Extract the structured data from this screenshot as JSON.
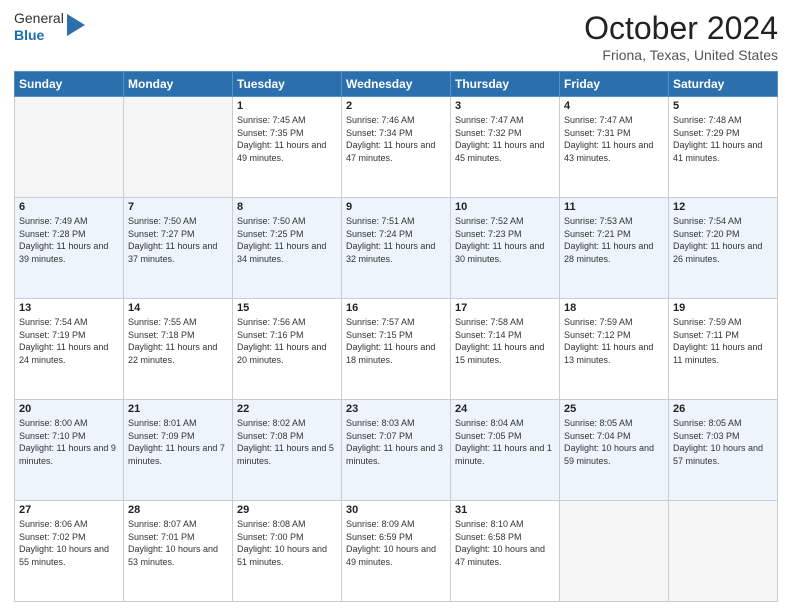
{
  "header": {
    "logo_general": "General",
    "logo_blue": "Blue",
    "title": "October 2024",
    "location": "Friona, Texas, United States"
  },
  "days_of_week": [
    "Sunday",
    "Monday",
    "Tuesday",
    "Wednesday",
    "Thursday",
    "Friday",
    "Saturday"
  ],
  "weeks": [
    [
      {
        "day": "",
        "sunrise": "",
        "sunset": "",
        "daylight": ""
      },
      {
        "day": "",
        "sunrise": "",
        "sunset": "",
        "daylight": ""
      },
      {
        "day": "1",
        "sunrise": "Sunrise: 7:45 AM",
        "sunset": "Sunset: 7:35 PM",
        "daylight": "Daylight: 11 hours and 49 minutes."
      },
      {
        "day": "2",
        "sunrise": "Sunrise: 7:46 AM",
        "sunset": "Sunset: 7:34 PM",
        "daylight": "Daylight: 11 hours and 47 minutes."
      },
      {
        "day": "3",
        "sunrise": "Sunrise: 7:47 AM",
        "sunset": "Sunset: 7:32 PM",
        "daylight": "Daylight: 11 hours and 45 minutes."
      },
      {
        "day": "4",
        "sunrise": "Sunrise: 7:47 AM",
        "sunset": "Sunset: 7:31 PM",
        "daylight": "Daylight: 11 hours and 43 minutes."
      },
      {
        "day": "5",
        "sunrise": "Sunrise: 7:48 AM",
        "sunset": "Sunset: 7:29 PM",
        "daylight": "Daylight: 11 hours and 41 minutes."
      }
    ],
    [
      {
        "day": "6",
        "sunrise": "Sunrise: 7:49 AM",
        "sunset": "Sunset: 7:28 PM",
        "daylight": "Daylight: 11 hours and 39 minutes."
      },
      {
        "day": "7",
        "sunrise": "Sunrise: 7:50 AM",
        "sunset": "Sunset: 7:27 PM",
        "daylight": "Daylight: 11 hours and 37 minutes."
      },
      {
        "day": "8",
        "sunrise": "Sunrise: 7:50 AM",
        "sunset": "Sunset: 7:25 PM",
        "daylight": "Daylight: 11 hours and 34 minutes."
      },
      {
        "day": "9",
        "sunrise": "Sunrise: 7:51 AM",
        "sunset": "Sunset: 7:24 PM",
        "daylight": "Daylight: 11 hours and 32 minutes."
      },
      {
        "day": "10",
        "sunrise": "Sunrise: 7:52 AM",
        "sunset": "Sunset: 7:23 PM",
        "daylight": "Daylight: 11 hours and 30 minutes."
      },
      {
        "day": "11",
        "sunrise": "Sunrise: 7:53 AM",
        "sunset": "Sunset: 7:21 PM",
        "daylight": "Daylight: 11 hours and 28 minutes."
      },
      {
        "day": "12",
        "sunrise": "Sunrise: 7:54 AM",
        "sunset": "Sunset: 7:20 PM",
        "daylight": "Daylight: 11 hours and 26 minutes."
      }
    ],
    [
      {
        "day": "13",
        "sunrise": "Sunrise: 7:54 AM",
        "sunset": "Sunset: 7:19 PM",
        "daylight": "Daylight: 11 hours and 24 minutes."
      },
      {
        "day": "14",
        "sunrise": "Sunrise: 7:55 AM",
        "sunset": "Sunset: 7:18 PM",
        "daylight": "Daylight: 11 hours and 22 minutes."
      },
      {
        "day": "15",
        "sunrise": "Sunrise: 7:56 AM",
        "sunset": "Sunset: 7:16 PM",
        "daylight": "Daylight: 11 hours and 20 minutes."
      },
      {
        "day": "16",
        "sunrise": "Sunrise: 7:57 AM",
        "sunset": "Sunset: 7:15 PM",
        "daylight": "Daylight: 11 hours and 18 minutes."
      },
      {
        "day": "17",
        "sunrise": "Sunrise: 7:58 AM",
        "sunset": "Sunset: 7:14 PM",
        "daylight": "Daylight: 11 hours and 15 minutes."
      },
      {
        "day": "18",
        "sunrise": "Sunrise: 7:59 AM",
        "sunset": "Sunset: 7:12 PM",
        "daylight": "Daylight: 11 hours and 13 minutes."
      },
      {
        "day": "19",
        "sunrise": "Sunrise: 7:59 AM",
        "sunset": "Sunset: 7:11 PM",
        "daylight": "Daylight: 11 hours and 11 minutes."
      }
    ],
    [
      {
        "day": "20",
        "sunrise": "Sunrise: 8:00 AM",
        "sunset": "Sunset: 7:10 PM",
        "daylight": "Daylight: 11 hours and 9 minutes."
      },
      {
        "day": "21",
        "sunrise": "Sunrise: 8:01 AM",
        "sunset": "Sunset: 7:09 PM",
        "daylight": "Daylight: 11 hours and 7 minutes."
      },
      {
        "day": "22",
        "sunrise": "Sunrise: 8:02 AM",
        "sunset": "Sunset: 7:08 PM",
        "daylight": "Daylight: 11 hours and 5 minutes."
      },
      {
        "day": "23",
        "sunrise": "Sunrise: 8:03 AM",
        "sunset": "Sunset: 7:07 PM",
        "daylight": "Daylight: 11 hours and 3 minutes."
      },
      {
        "day": "24",
        "sunrise": "Sunrise: 8:04 AM",
        "sunset": "Sunset: 7:05 PM",
        "daylight": "Daylight: 11 hours and 1 minute."
      },
      {
        "day": "25",
        "sunrise": "Sunrise: 8:05 AM",
        "sunset": "Sunset: 7:04 PM",
        "daylight": "Daylight: 10 hours and 59 minutes."
      },
      {
        "day": "26",
        "sunrise": "Sunrise: 8:05 AM",
        "sunset": "Sunset: 7:03 PM",
        "daylight": "Daylight: 10 hours and 57 minutes."
      }
    ],
    [
      {
        "day": "27",
        "sunrise": "Sunrise: 8:06 AM",
        "sunset": "Sunset: 7:02 PM",
        "daylight": "Daylight: 10 hours and 55 minutes."
      },
      {
        "day": "28",
        "sunrise": "Sunrise: 8:07 AM",
        "sunset": "Sunset: 7:01 PM",
        "daylight": "Daylight: 10 hours and 53 minutes."
      },
      {
        "day": "29",
        "sunrise": "Sunrise: 8:08 AM",
        "sunset": "Sunset: 7:00 PM",
        "daylight": "Daylight: 10 hours and 51 minutes."
      },
      {
        "day": "30",
        "sunrise": "Sunrise: 8:09 AM",
        "sunset": "Sunset: 6:59 PM",
        "daylight": "Daylight: 10 hours and 49 minutes."
      },
      {
        "day": "31",
        "sunrise": "Sunrise: 8:10 AM",
        "sunset": "Sunset: 6:58 PM",
        "daylight": "Daylight: 10 hours and 47 minutes."
      },
      {
        "day": "",
        "sunrise": "",
        "sunset": "",
        "daylight": ""
      },
      {
        "day": "",
        "sunrise": "",
        "sunset": "",
        "daylight": ""
      }
    ]
  ]
}
